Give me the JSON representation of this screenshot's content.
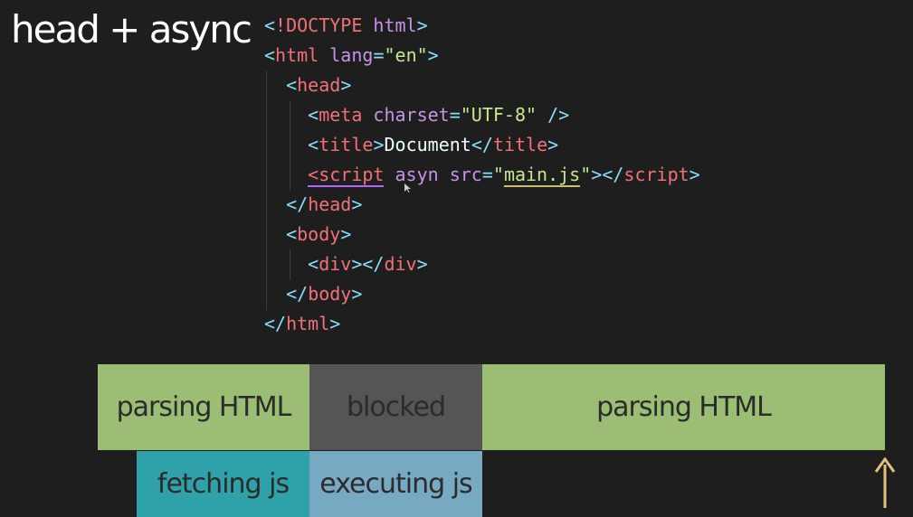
{
  "title": "head + async",
  "code_lines": [
    [
      {
        "t": "<",
        "c": "punct"
      },
      {
        "t": "!DOCTYPE",
        "c": "tag"
      },
      {
        "t": " html",
        "c": "attr"
      },
      {
        "t": ">",
        "c": "punct"
      }
    ],
    [
      {
        "t": "<",
        "c": "punct"
      },
      {
        "t": "html",
        "c": "tag"
      },
      {
        "t": " lang",
        "c": "attr"
      },
      {
        "t": "=",
        "c": "punct"
      },
      {
        "t": "\"en\"",
        "c": "str"
      },
      {
        "t": ">",
        "c": "punct"
      }
    ],
    [
      {
        "t": "  "
      },
      {
        "t": "<",
        "c": "punct"
      },
      {
        "t": "head",
        "c": "tag"
      },
      {
        "t": ">",
        "c": "punct"
      }
    ],
    [
      {
        "t": "    "
      },
      {
        "t": "<",
        "c": "punct"
      },
      {
        "t": "meta",
        "c": "tag"
      },
      {
        "t": " charset",
        "c": "attr"
      },
      {
        "t": "=",
        "c": "punct"
      },
      {
        "t": "\"UTF-8\"",
        "c": "str"
      },
      {
        "t": " />",
        "c": "punct"
      }
    ],
    [
      {
        "t": "    "
      },
      {
        "t": "<",
        "c": "punct"
      },
      {
        "t": "title",
        "c": "tag"
      },
      {
        "t": ">",
        "c": "punct"
      },
      {
        "t": "Document",
        "c": "text"
      },
      {
        "t": "</",
        "c": "punct"
      },
      {
        "t": "title",
        "c": "tag"
      },
      {
        "t": ">",
        "c": "punct"
      }
    ],
    [
      {
        "t": "    "
      },
      {
        "t": "<script",
        "c": "tag squiggle-purple"
      },
      {
        "t": " asyn src",
        "c": "attr"
      },
      {
        "t": "=",
        "c": "punct"
      },
      {
        "t": "\"",
        "c": "str"
      },
      {
        "t": "main.js",
        "c": "str squiggle-yellow"
      },
      {
        "t": "\"",
        "c": "str"
      },
      {
        "t": "></",
        "c": "punct"
      },
      {
        "t": "script",
        "c": "tag"
      },
      {
        "t": ">",
        "c": "punct"
      }
    ],
    [
      {
        "t": "  "
      },
      {
        "t": "</",
        "c": "punct"
      },
      {
        "t": "head",
        "c": "tag"
      },
      {
        "t": ">",
        "c": "punct"
      }
    ],
    [
      {
        "t": "  "
      },
      {
        "t": "<",
        "c": "punct"
      },
      {
        "t": "body",
        "c": "tag"
      },
      {
        "t": ">",
        "c": "punct"
      }
    ],
    [
      {
        "t": "    "
      },
      {
        "t": "<",
        "c": "punct"
      },
      {
        "t": "div",
        "c": "tag"
      },
      {
        "t": "></",
        "c": "punct"
      },
      {
        "t": "div",
        "c": "tag"
      },
      {
        "t": ">",
        "c": "punct"
      }
    ],
    [
      {
        "t": "  "
      },
      {
        "t": "</",
        "c": "punct"
      },
      {
        "t": "body",
        "c": "tag"
      },
      {
        "t": ">",
        "c": "punct"
      }
    ],
    [
      {
        "t": "</",
        "c": "punct"
      },
      {
        "t": "html",
        "c": "tag"
      },
      {
        "t": ">",
        "c": "punct"
      }
    ]
  ],
  "timeline": {
    "parsing_1": "parsing HTML",
    "blocked": "blocked",
    "parsing_2": "parsing HTML",
    "fetching": "fetching js",
    "executing": "executing js"
  },
  "colors": {
    "parsing": "#9bbd74",
    "blocked": "#555555",
    "fetching": "#2fa1a8",
    "executing": "#78a9c2",
    "arrow": "#e0c37d"
  }
}
